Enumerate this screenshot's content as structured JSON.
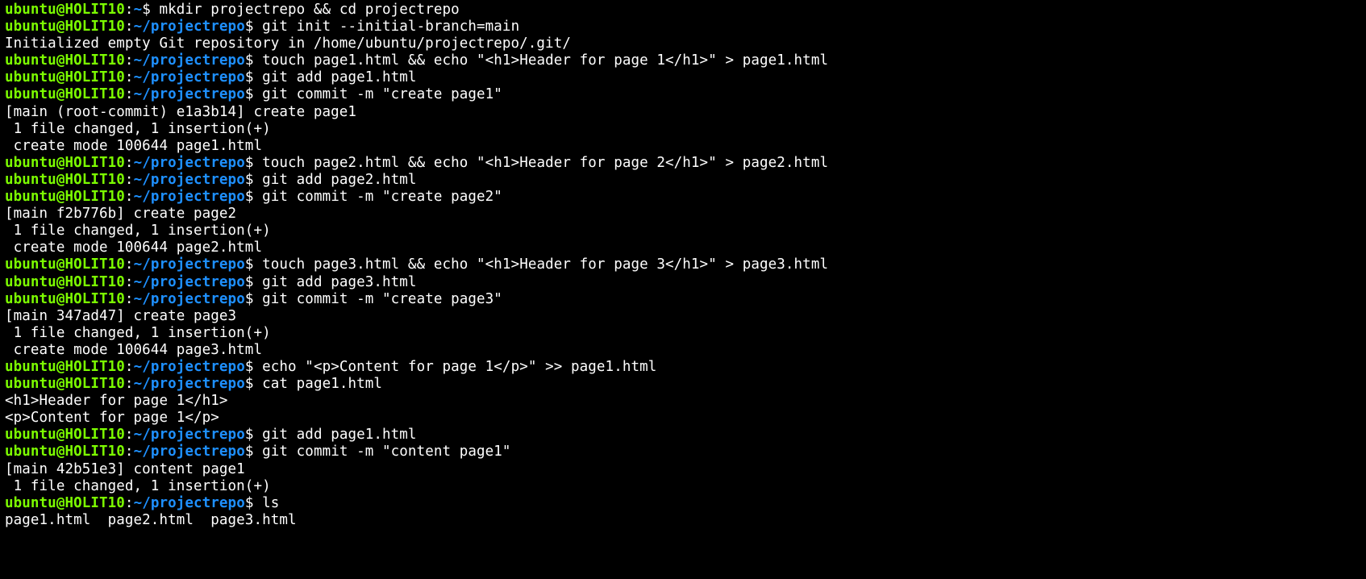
{
  "prompt": {
    "user": "ubuntu",
    "at": "@",
    "host": "HOLIT10",
    "colon": ":",
    "home": "~",
    "path": "/projectrepo",
    "dollar": "$ "
  },
  "lines": [
    {
      "type": "cmd",
      "show_path": false,
      "text": "mkdir projectrepo && cd projectrepo"
    },
    {
      "type": "cmd",
      "show_path": true,
      "text": "git init --initial-branch=main"
    },
    {
      "type": "out",
      "text": "Initialized empty Git repository in /home/ubuntu/projectrepo/.git/"
    },
    {
      "type": "cmd",
      "show_path": true,
      "text": "touch page1.html && echo \"<h1>Header for page 1</h1>\" > page1.html"
    },
    {
      "type": "cmd",
      "show_path": true,
      "text": "git add page1.html"
    },
    {
      "type": "cmd",
      "show_path": true,
      "text": "git commit -m \"create page1\""
    },
    {
      "type": "out",
      "text": "[main (root-commit) e1a3b14] create page1"
    },
    {
      "type": "out",
      "text": " 1 file changed, 1 insertion(+)"
    },
    {
      "type": "out",
      "text": " create mode 100644 page1.html"
    },
    {
      "type": "cmd",
      "show_path": true,
      "text": "touch page2.html && echo \"<h1>Header for page 2</h1>\" > page2.html"
    },
    {
      "type": "cmd",
      "show_path": true,
      "text": "git add page2.html"
    },
    {
      "type": "cmd",
      "show_path": true,
      "text": "git commit -m \"create page2\""
    },
    {
      "type": "out",
      "text": "[main f2b776b] create page2"
    },
    {
      "type": "out",
      "text": " 1 file changed, 1 insertion(+)"
    },
    {
      "type": "out",
      "text": " create mode 100644 page2.html"
    },
    {
      "type": "cmd",
      "show_path": true,
      "text": "touch page3.html && echo \"<h1>Header for page 3</h1>\" > page3.html"
    },
    {
      "type": "cmd",
      "show_path": true,
      "text": "git add page3.html"
    },
    {
      "type": "cmd",
      "show_path": true,
      "text": "git commit -m \"create page3\""
    },
    {
      "type": "out",
      "text": "[main 347ad47] create page3"
    },
    {
      "type": "out",
      "text": " 1 file changed, 1 insertion(+)"
    },
    {
      "type": "out",
      "text": " create mode 100644 page3.html"
    },
    {
      "type": "cmd",
      "show_path": true,
      "text": "echo \"<p>Content for page 1</p>\" >> page1.html"
    },
    {
      "type": "cmd",
      "show_path": true,
      "text": "cat page1.html"
    },
    {
      "type": "out",
      "text": "<h1>Header for page 1</h1>"
    },
    {
      "type": "out",
      "text": "<p>Content for page 1</p>"
    },
    {
      "type": "cmd",
      "show_path": true,
      "text": "git add page1.html"
    },
    {
      "type": "cmd",
      "show_path": true,
      "text": "git commit -m \"content page1\""
    },
    {
      "type": "out",
      "text": "[main 42b51e3] content page1"
    },
    {
      "type": "out",
      "text": " 1 file changed, 1 insertion(+)"
    },
    {
      "type": "cmd",
      "show_path": true,
      "text": "ls"
    },
    {
      "type": "out",
      "text": "page1.html  page2.html  page3.html"
    }
  ]
}
